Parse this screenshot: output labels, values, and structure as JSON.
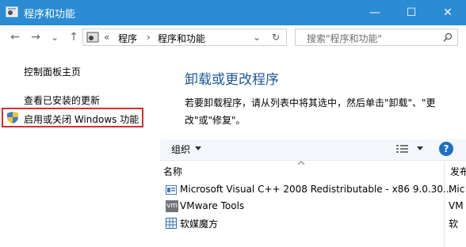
{
  "window": {
    "title": "程序和功能",
    "minimize": "—",
    "maximize": "☐",
    "close": "✕"
  },
  "nav": {
    "back": "←",
    "forward": "→",
    "dropdown": "⌄",
    "up": "↑",
    "breadcrumb_overflow": "«",
    "breadcrumb": [
      "程序",
      "程序和功能"
    ],
    "separator": "›",
    "refresh": "↻",
    "search_placeholder": "搜索\"程序和功能\""
  },
  "sidebar": {
    "items": [
      {
        "label": "控制面板主页"
      },
      {
        "label": "查看已安装的更新"
      },
      {
        "label": "启用或关闭 Windows 功能"
      }
    ]
  },
  "main": {
    "heading": "卸载或更改程序",
    "description": "若要卸载程序，请从列表中将其选中，然后单击\"卸载\"、\"更改\"或\"修复\"。",
    "toolbar": {
      "organize_label": "组织",
      "help": "?"
    },
    "columns": [
      "名称",
      "发布"
    ],
    "programs": [
      {
        "name": "Microsoft Visual C++ 2008 Redistributable - x86 9.0.30...",
        "publisher": "Mic"
      },
      {
        "name": "VMware Tools",
        "publisher": "VM"
      },
      {
        "name": "软媒魔方",
        "publisher": "软"
      }
    ]
  },
  "colors": {
    "titlebar": "#2b8bd3",
    "heading": "#1e5799",
    "highlight": "#d32f2f"
  }
}
